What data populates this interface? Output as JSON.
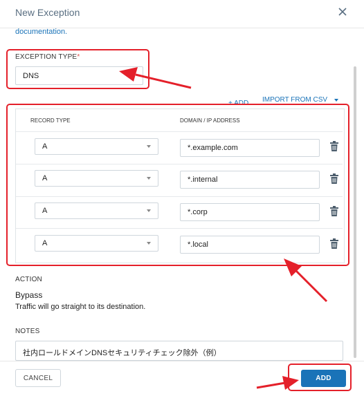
{
  "dialog": {
    "title": "New Exception"
  },
  "intro": {
    "link_text": "documentation."
  },
  "exception_type": {
    "label": "EXCEPTION TYPE",
    "required_mark": "*",
    "value": "DNS"
  },
  "actions": {
    "add_link": "+ ADD",
    "import_link": "IMPORT FROM CSV"
  },
  "records": {
    "headers": [
      "RECORD TYPE",
      "DOMAIN / IP ADDRESS"
    ],
    "rows": [
      {
        "type": "A",
        "domain": "*.example.com"
      },
      {
        "type": "A",
        "domain": "*.internal"
      },
      {
        "type": "A",
        "domain": "*.corp"
      },
      {
        "type": "A",
        "domain": "*.local"
      }
    ]
  },
  "action_section": {
    "label": "ACTION",
    "value": "Bypass",
    "description": "Traffic will go straight to its destination."
  },
  "notes": {
    "label": "NOTES",
    "value": "社内ロールドメインDNSセキュリティチェック除外（例）"
  },
  "footer": {
    "cancel_label": "CANCEL",
    "add_label": "ADD"
  },
  "colors": {
    "accent": "#1a73b8",
    "annotation": "#e4202a"
  },
  "icons": [
    "close-icon",
    "chevron-down-icon",
    "trash-icon",
    "annotation-arrow"
  ]
}
